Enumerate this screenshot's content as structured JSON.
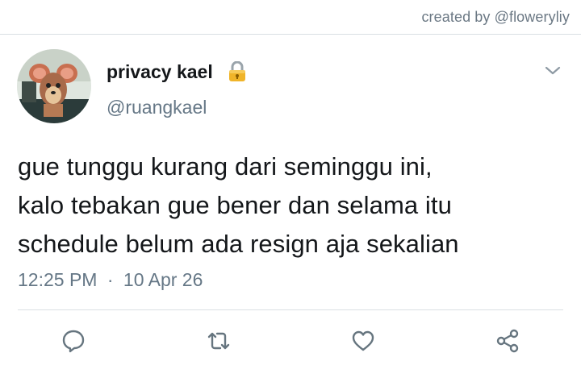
{
  "credit": "created by @floweryliy",
  "tweet": {
    "display_name": "privacy kael",
    "handle": "@ruangkael",
    "lines": [
      "gue tunggu kurang dari seminggu ini,",
      "kalo tebakan gue bener dan selama itu",
      "schedule belum ada resign aja sekalian"
    ],
    "time": "12:25 PM",
    "separator": "·",
    "date": "10 Apr 26"
  },
  "icons": {
    "verified_lock": "lock-icon",
    "menu": "chevron-down-icon",
    "reply": "reply-icon",
    "retweet": "retweet-icon",
    "like": "heart-icon",
    "share": "share-icon"
  },
  "colors": {
    "text": "#14171a",
    "secondary": "#657786",
    "divider": "#dadfe3",
    "lock": "#f0b429"
  }
}
